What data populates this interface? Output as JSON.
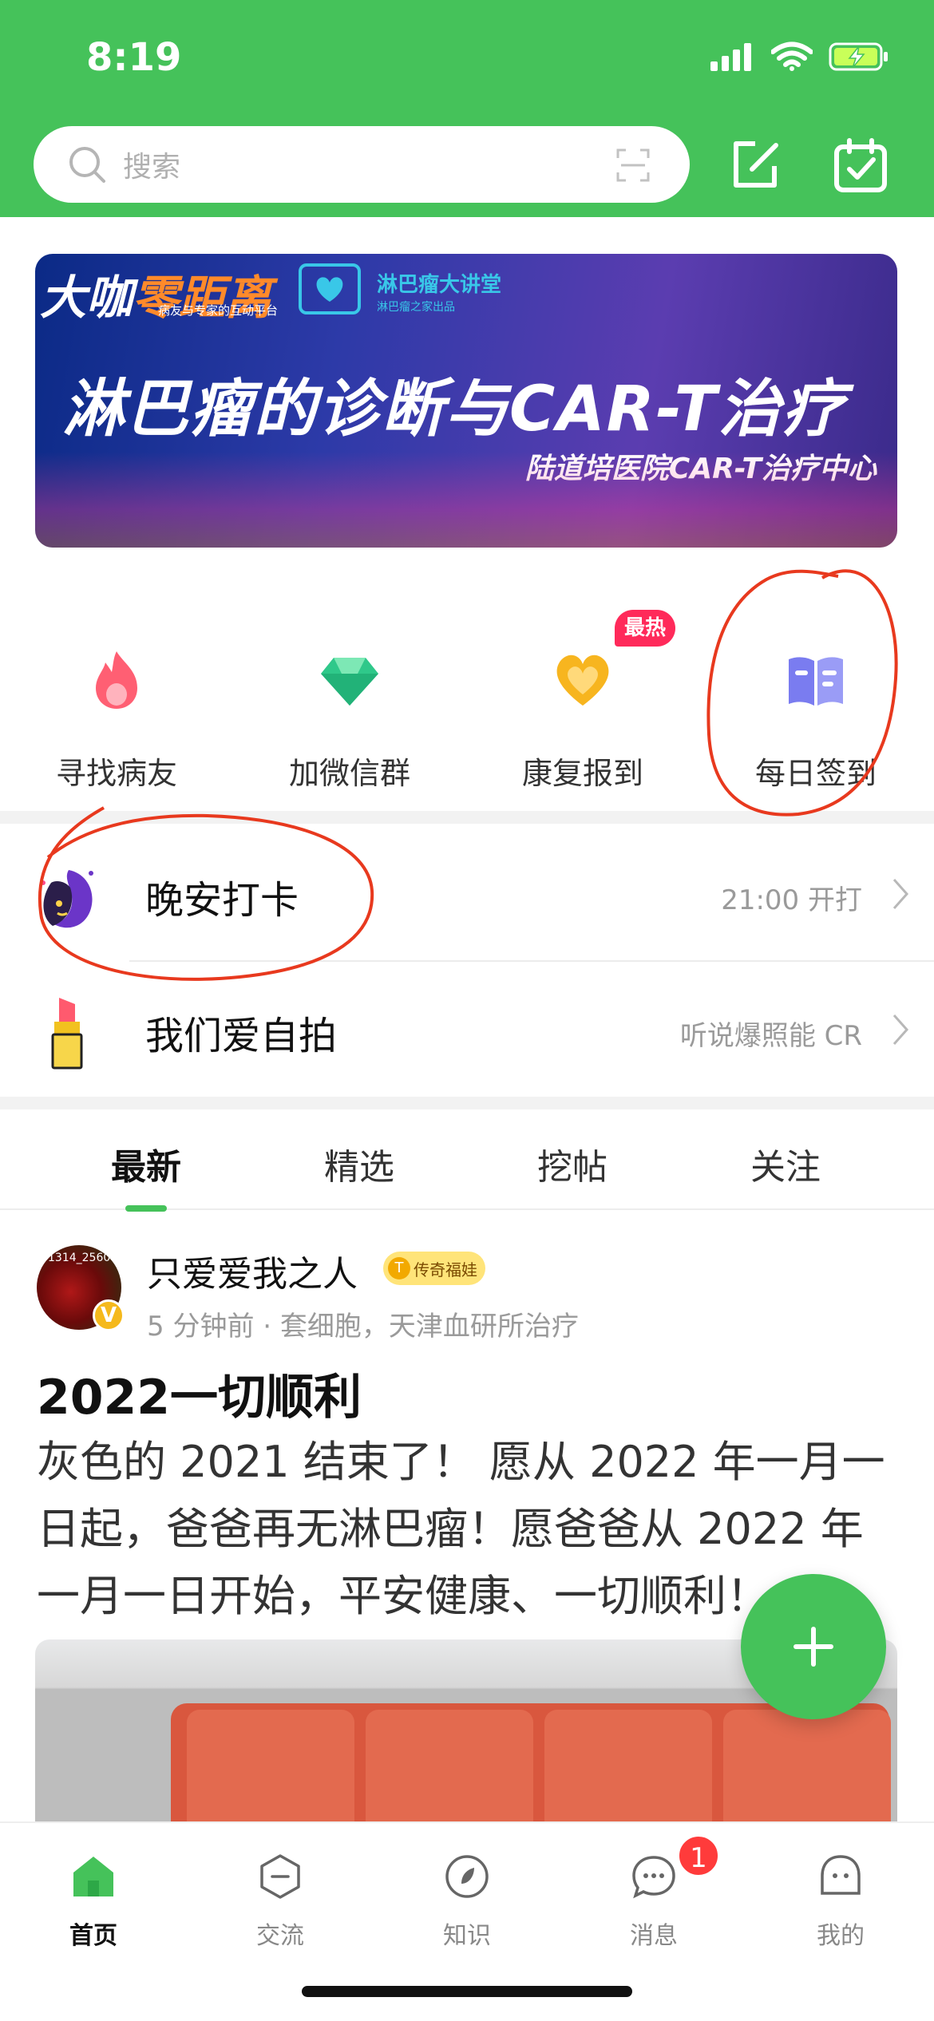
{
  "status_bar": {
    "time": "8:19"
  },
  "search": {
    "placeholder": "搜索"
  },
  "banner": {
    "brand_prefix": "大咖",
    "brand_suffix": "零距离",
    "brand_sub": "病友与专家的互动平台",
    "lecture_name": "淋巴瘤大讲堂",
    "lecture_sub": "淋巴瘤之家出品",
    "title": "淋巴瘤的诊断与CAR-T治疗",
    "subtitle": "陆道培医院CAR-T治疗中心"
  },
  "quick_entries": [
    {
      "label": "寻找病友",
      "icon": "flame-icon",
      "color": "#ff5f73"
    },
    {
      "label": "加微信群",
      "icon": "diamond-icon",
      "color": "#2fc88a"
    },
    {
      "label": "康复报到",
      "icon": "heart-icon",
      "color": "#f7b51f"
    },
    {
      "label": "每日签到",
      "icon": "book-icon",
      "color": "#7a7cf0"
    }
  ],
  "hot_badge": "最热",
  "rows": [
    {
      "title": "晚安打卡",
      "right_text": "21:00 开打",
      "icon": "eggplant-moon-icon"
    },
    {
      "title": "我们爱自拍",
      "right_text": "听说爆照能 CR",
      "icon": "lipstick-icon"
    }
  ],
  "tabs": [
    {
      "label": "最新",
      "active": true
    },
    {
      "label": "精选",
      "active": false
    },
    {
      "label": "挖帖",
      "active": false
    },
    {
      "label": "关注",
      "active": false
    }
  ],
  "post": {
    "username": "只爱爱我之人",
    "badge": "传奇福娃",
    "avatar_watermark": "1314_2560",
    "meta": "5 分钟前 · 套细胞，天津血研所治疗",
    "title": "2022一切顺利",
    "body": "灰色的 2021 结束了！ 愿从 2022 年一月一日起，爸爸再无淋巴瘤！愿爸爸从 2022 年一月一日开始，平安健康、一切顺利！"
  },
  "bottom_nav": [
    {
      "label": "首页",
      "icon": "home-icon",
      "active": true
    },
    {
      "label": "交流",
      "icon": "chat-circle-icon",
      "active": false
    },
    {
      "label": "知识",
      "icon": "knowledge-icon",
      "active": false
    },
    {
      "label": "消息",
      "icon": "message-icon",
      "active": false
    },
    {
      "label": "我的",
      "icon": "profile-icon",
      "active": false
    }
  ],
  "message_badge": "1",
  "colors": {
    "brand_green": "#45c25a",
    "annotation_red": "#e8391e",
    "badge_red": "#ff2a5a"
  }
}
